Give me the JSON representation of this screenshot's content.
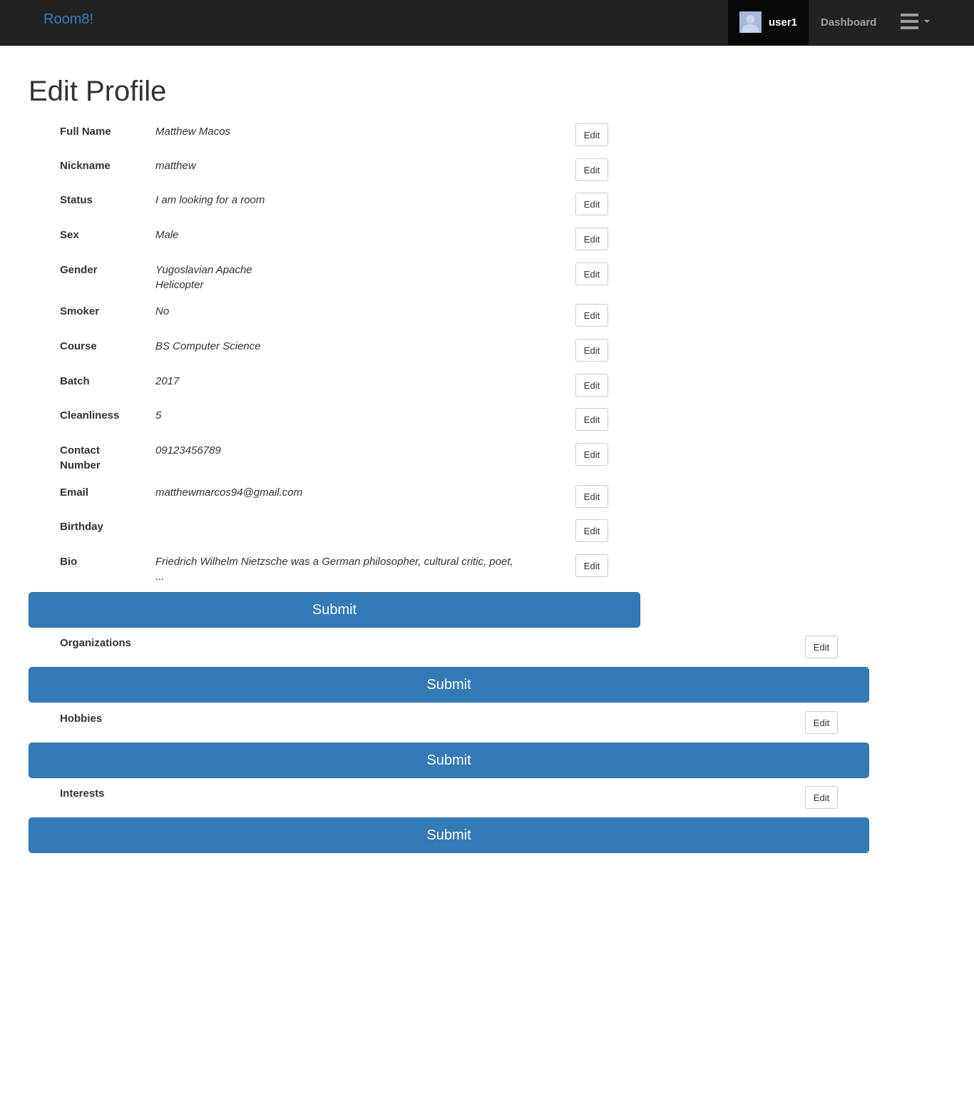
{
  "navbar": {
    "brand": "Room8!",
    "user_name": "user1",
    "dashboard_label": "Dashboard",
    "avatar_icon": "user-avatar-icon",
    "menu_icon": "hamburger-menu-icon"
  },
  "page": {
    "title": "Edit Profile"
  },
  "profile": {
    "edit_label": "Edit",
    "fields": [
      {
        "label": "Full Name",
        "value": "Matthew Macos"
      },
      {
        "label": "Nickname",
        "value": "matthew"
      },
      {
        "label": "Status",
        "value": "I am looking for a room"
      },
      {
        "label": "Sex",
        "value": "Male"
      },
      {
        "label": "Gender",
        "value": "Yugoslavian Apache Helicopter"
      },
      {
        "label": "Smoker",
        "value": "No"
      },
      {
        "label": "Course",
        "value": "BS Computer Science"
      },
      {
        "label": "Batch",
        "value": "2017"
      },
      {
        "label": "Cleanliness",
        "value": "5"
      },
      {
        "label": "Contact Number",
        "value": "09123456789"
      },
      {
        "label": "Email",
        "value": "matthewmarcos94@gmail.com"
      },
      {
        "label": "Birthday",
        "value": ""
      },
      {
        "label": "Bio",
        "value": "Friedrich Wilhelm Nietzsche was a German philosopher, cultural critic, poet, ..."
      }
    ],
    "submit_label": "Submit"
  },
  "sections": [
    {
      "label": "Organizations",
      "edit_label": "Edit",
      "submit_label": "Submit"
    },
    {
      "label": "Hobbies",
      "edit_label": "Edit",
      "submit_label": "Submit"
    },
    {
      "label": "Interests",
      "edit_label": "Edit",
      "submit_label": "Submit"
    }
  ],
  "colors": {
    "navbar_bg": "#222222",
    "brand": "#337ab7",
    "primary_button": "#337ab7"
  }
}
